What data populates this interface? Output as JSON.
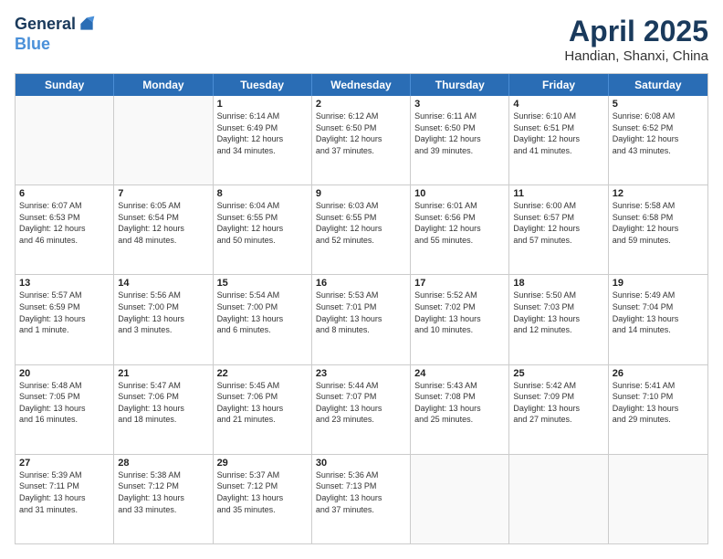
{
  "header": {
    "logo_line1": "General",
    "logo_line2": "Blue",
    "month_title": "April 2025",
    "subtitle": "Handian, Shanxi, China"
  },
  "days": [
    "Sunday",
    "Monday",
    "Tuesday",
    "Wednesday",
    "Thursday",
    "Friday",
    "Saturday"
  ],
  "rows": [
    [
      {
        "day": "",
        "text": ""
      },
      {
        "day": "",
        "text": ""
      },
      {
        "day": "1",
        "text": "Sunrise: 6:14 AM\nSunset: 6:49 PM\nDaylight: 12 hours\nand 34 minutes."
      },
      {
        "day": "2",
        "text": "Sunrise: 6:12 AM\nSunset: 6:50 PM\nDaylight: 12 hours\nand 37 minutes."
      },
      {
        "day": "3",
        "text": "Sunrise: 6:11 AM\nSunset: 6:50 PM\nDaylight: 12 hours\nand 39 minutes."
      },
      {
        "day": "4",
        "text": "Sunrise: 6:10 AM\nSunset: 6:51 PM\nDaylight: 12 hours\nand 41 minutes."
      },
      {
        "day": "5",
        "text": "Sunrise: 6:08 AM\nSunset: 6:52 PM\nDaylight: 12 hours\nand 43 minutes."
      }
    ],
    [
      {
        "day": "6",
        "text": "Sunrise: 6:07 AM\nSunset: 6:53 PM\nDaylight: 12 hours\nand 46 minutes."
      },
      {
        "day": "7",
        "text": "Sunrise: 6:05 AM\nSunset: 6:54 PM\nDaylight: 12 hours\nand 48 minutes."
      },
      {
        "day": "8",
        "text": "Sunrise: 6:04 AM\nSunset: 6:55 PM\nDaylight: 12 hours\nand 50 minutes."
      },
      {
        "day": "9",
        "text": "Sunrise: 6:03 AM\nSunset: 6:55 PM\nDaylight: 12 hours\nand 52 minutes."
      },
      {
        "day": "10",
        "text": "Sunrise: 6:01 AM\nSunset: 6:56 PM\nDaylight: 12 hours\nand 55 minutes."
      },
      {
        "day": "11",
        "text": "Sunrise: 6:00 AM\nSunset: 6:57 PM\nDaylight: 12 hours\nand 57 minutes."
      },
      {
        "day": "12",
        "text": "Sunrise: 5:58 AM\nSunset: 6:58 PM\nDaylight: 12 hours\nand 59 minutes."
      }
    ],
    [
      {
        "day": "13",
        "text": "Sunrise: 5:57 AM\nSunset: 6:59 PM\nDaylight: 13 hours\nand 1 minute."
      },
      {
        "day": "14",
        "text": "Sunrise: 5:56 AM\nSunset: 7:00 PM\nDaylight: 13 hours\nand 3 minutes."
      },
      {
        "day": "15",
        "text": "Sunrise: 5:54 AM\nSunset: 7:00 PM\nDaylight: 13 hours\nand 6 minutes."
      },
      {
        "day": "16",
        "text": "Sunrise: 5:53 AM\nSunset: 7:01 PM\nDaylight: 13 hours\nand 8 minutes."
      },
      {
        "day": "17",
        "text": "Sunrise: 5:52 AM\nSunset: 7:02 PM\nDaylight: 13 hours\nand 10 minutes."
      },
      {
        "day": "18",
        "text": "Sunrise: 5:50 AM\nSunset: 7:03 PM\nDaylight: 13 hours\nand 12 minutes."
      },
      {
        "day": "19",
        "text": "Sunrise: 5:49 AM\nSunset: 7:04 PM\nDaylight: 13 hours\nand 14 minutes."
      }
    ],
    [
      {
        "day": "20",
        "text": "Sunrise: 5:48 AM\nSunset: 7:05 PM\nDaylight: 13 hours\nand 16 minutes."
      },
      {
        "day": "21",
        "text": "Sunrise: 5:47 AM\nSunset: 7:06 PM\nDaylight: 13 hours\nand 18 minutes."
      },
      {
        "day": "22",
        "text": "Sunrise: 5:45 AM\nSunset: 7:06 PM\nDaylight: 13 hours\nand 21 minutes."
      },
      {
        "day": "23",
        "text": "Sunrise: 5:44 AM\nSunset: 7:07 PM\nDaylight: 13 hours\nand 23 minutes."
      },
      {
        "day": "24",
        "text": "Sunrise: 5:43 AM\nSunset: 7:08 PM\nDaylight: 13 hours\nand 25 minutes."
      },
      {
        "day": "25",
        "text": "Sunrise: 5:42 AM\nSunset: 7:09 PM\nDaylight: 13 hours\nand 27 minutes."
      },
      {
        "day": "26",
        "text": "Sunrise: 5:41 AM\nSunset: 7:10 PM\nDaylight: 13 hours\nand 29 minutes."
      }
    ],
    [
      {
        "day": "27",
        "text": "Sunrise: 5:39 AM\nSunset: 7:11 PM\nDaylight: 13 hours\nand 31 minutes."
      },
      {
        "day": "28",
        "text": "Sunrise: 5:38 AM\nSunset: 7:12 PM\nDaylight: 13 hours\nand 33 minutes."
      },
      {
        "day": "29",
        "text": "Sunrise: 5:37 AM\nSunset: 7:12 PM\nDaylight: 13 hours\nand 35 minutes."
      },
      {
        "day": "30",
        "text": "Sunrise: 5:36 AM\nSunset: 7:13 PM\nDaylight: 13 hours\nand 37 minutes."
      },
      {
        "day": "",
        "text": ""
      },
      {
        "day": "",
        "text": ""
      },
      {
        "day": "",
        "text": ""
      }
    ]
  ]
}
